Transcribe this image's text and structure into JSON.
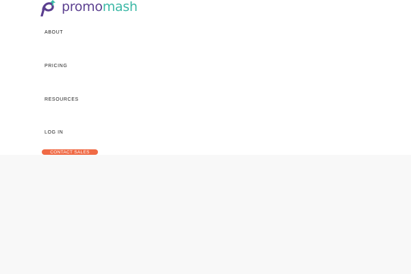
{
  "brand": {
    "name_part1": "promo",
    "name_part2": "mash",
    "logo_icon": "promomash-logo-icon",
    "color_primary": "#5b3f8f",
    "color_secondary": "#3cb8a6"
  },
  "nav": {
    "items": [
      {
        "label": "ABOUT"
      },
      {
        "label": "PRICING"
      },
      {
        "label": "RESOURCES"
      },
      {
        "label": "LOG IN"
      }
    ],
    "cta_label": "CONTACT SALES",
    "cta_color": "#f06a45"
  },
  "background": {
    "lower_band_color": "#f8f8f8"
  }
}
